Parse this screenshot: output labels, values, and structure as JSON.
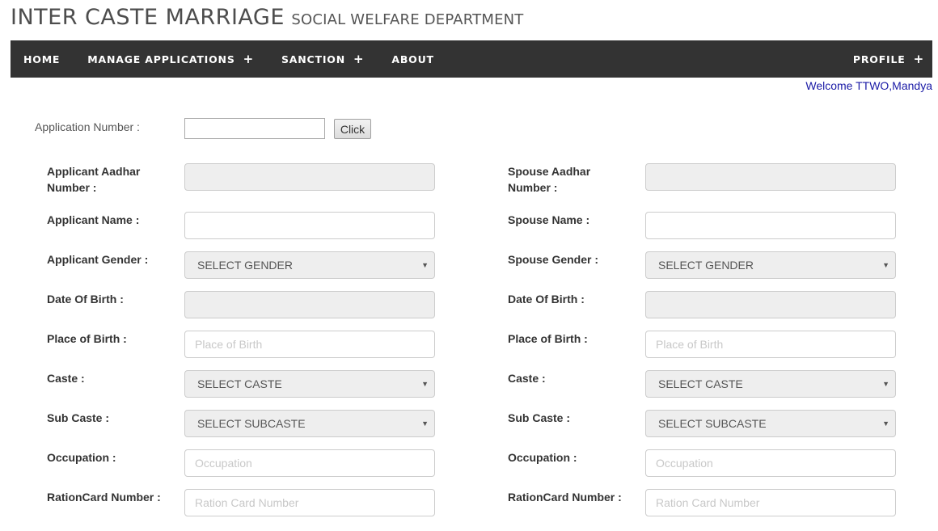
{
  "header": {
    "title": "INTER CASTE MARRIAGE",
    "subtitle": "SOCIAL WELFARE DEPARTMENT"
  },
  "nav": {
    "home": "HOME",
    "manage_applications": "MANAGE APPLICATIONS",
    "sanction": "SANCTION",
    "about": "ABOUT",
    "profile": "PROFILE",
    "plus": "+",
    "colors": {
      "bar": "#333333",
      "text": "#ffffff"
    }
  },
  "welcome": "Welcome TTWO,Mandya",
  "application": {
    "label": "Application Number :",
    "value": "",
    "button": "Click"
  },
  "form": {
    "applicant_aadhar_label": "Applicant Aadhar Number :",
    "spouse_aadhar_label": "Spouse Aadhar Number :",
    "applicant_name_label": "Applicant Name :",
    "spouse_name_label": "Spouse Name :",
    "applicant_gender_label": "Applicant Gender :",
    "spouse_gender_label": "Spouse Gender :",
    "select_gender": "SELECT GENDER",
    "dob_label": "Date Of Birth :",
    "pob_label": "Place of Birth :",
    "pob_placeholder": "Place of Birth",
    "caste_label": "Caste :",
    "select_caste": "SELECT CASTE",
    "subcaste_label": "Sub Caste :",
    "select_subcaste": "SELECT SUBCASTE",
    "occupation_label": "Occupation :",
    "occupation_placeholder": "Occupation",
    "ration_label": "RationCard Number :",
    "ration_placeholder": "Ration Card Number",
    "caret": "▼"
  }
}
